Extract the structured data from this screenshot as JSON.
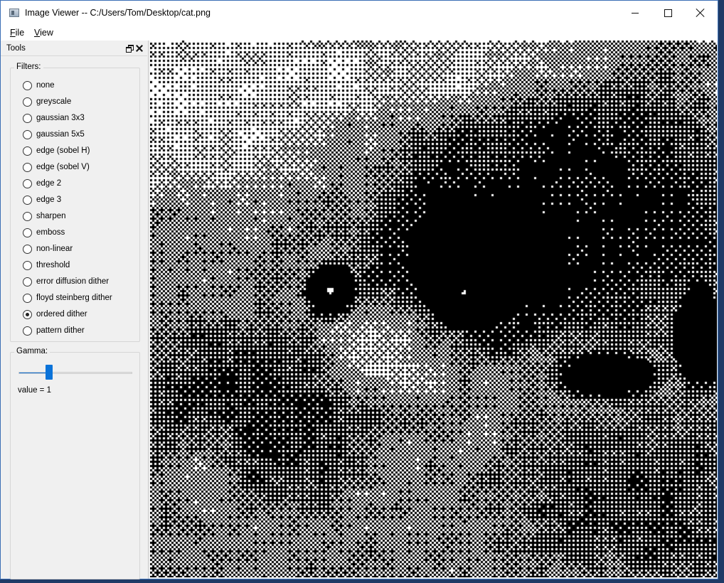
{
  "window": {
    "title": "Image Viewer -- C:/Users/Tom/Desktop/cat.png"
  },
  "menubar": {
    "items": [
      {
        "label": "File"
      },
      {
        "label": "View"
      }
    ]
  },
  "dock": {
    "title": "Tools",
    "float_icon": "dock-float-icon",
    "close_icon": "close-icon"
  },
  "filters": {
    "title": "Filters:",
    "selected": "ordered dither",
    "options": [
      {
        "label": "none",
        "checked": false
      },
      {
        "label": "greyscale",
        "checked": false
      },
      {
        "label": "gaussian 3x3",
        "checked": false
      },
      {
        "label": "gaussian 5x5",
        "checked": false
      },
      {
        "label": "edge (sobel H)",
        "checked": false
      },
      {
        "label": "edge (sobel V)",
        "checked": false
      },
      {
        "label": "edge 2",
        "checked": false
      },
      {
        "label": "edge 3",
        "checked": false
      },
      {
        "label": "sharpen",
        "checked": false
      },
      {
        "label": "emboss",
        "checked": false
      },
      {
        "label": "non-linear",
        "checked": false
      },
      {
        "label": "threshold",
        "checked": false
      },
      {
        "label": "error diffusion dither",
        "checked": false
      },
      {
        "label": "floyd steinberg dither",
        "checked": false
      },
      {
        "label": "ordered dither",
        "checked": true
      },
      {
        "label": "pattern dither",
        "checked": false
      }
    ]
  },
  "gamma": {
    "title": "Gamma:",
    "slider_fraction": 0.27,
    "value_text": "value = 1"
  },
  "colors": {
    "accent": "#0b73d9",
    "title_bar": "#ffffff",
    "panel": "#f0f0f0",
    "window_border": "#3c6fb5"
  }
}
